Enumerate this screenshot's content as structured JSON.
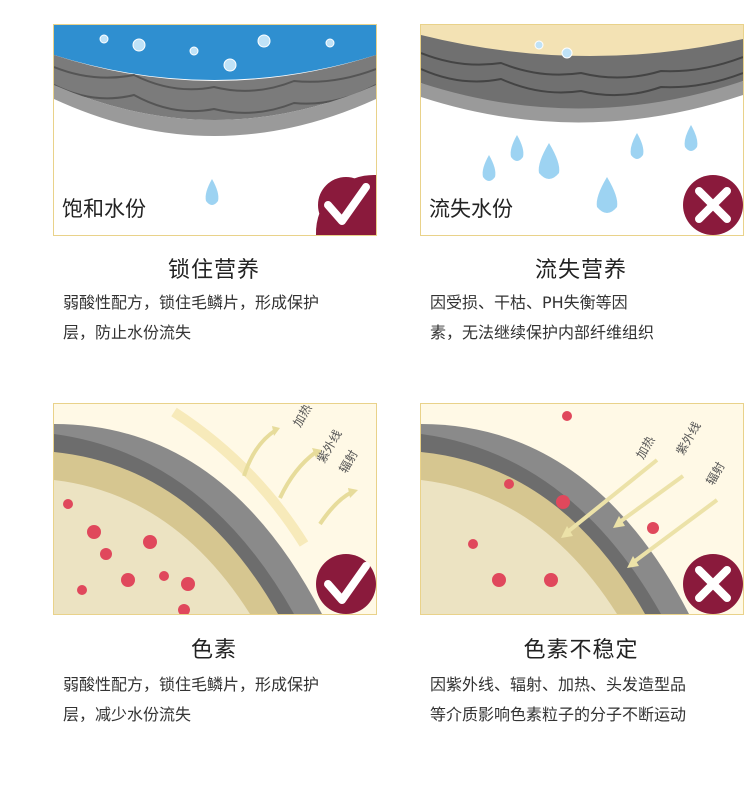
{
  "panels": [
    {
      "label": "饱和水份",
      "title": "锁住营养",
      "desc": [
        "弱酸性配方，锁住毛鳞片，形成保护",
        "层，防止水份流失"
      ],
      "status": "check"
    },
    {
      "label": "流失水份",
      "title": "流失营养",
      "desc": [
        "因受损、干枯、PH失衡等因",
        "素，无法继续保护内部纤维组织"
      ],
      "status": "cross"
    },
    {
      "label": "",
      "title": "色素",
      "desc": [
        "弱酸性配方，锁住毛鳞片，形成保护",
        "层，减少水份流失"
      ],
      "status": "check",
      "arrows": [
        "加热",
        "紫外线",
        "辐射"
      ]
    },
    {
      "label": "",
      "title": "色素不稳定",
      "desc": [
        "因紫外线、辐射、加热、头发造型品",
        "等介质影响色素粒子的分子不断运动"
      ],
      "status": "cross",
      "arrows": [
        "加热",
        "紫外线",
        "辐射"
      ]
    }
  ],
  "colors": {
    "check_bg": "#8a1a3c",
    "cross_bg": "#8a1a3c",
    "water": "#2f8fd0",
    "cortex": "#e7ddb6",
    "scale": "#6f6f6f",
    "pigment": "#e0485c"
  }
}
